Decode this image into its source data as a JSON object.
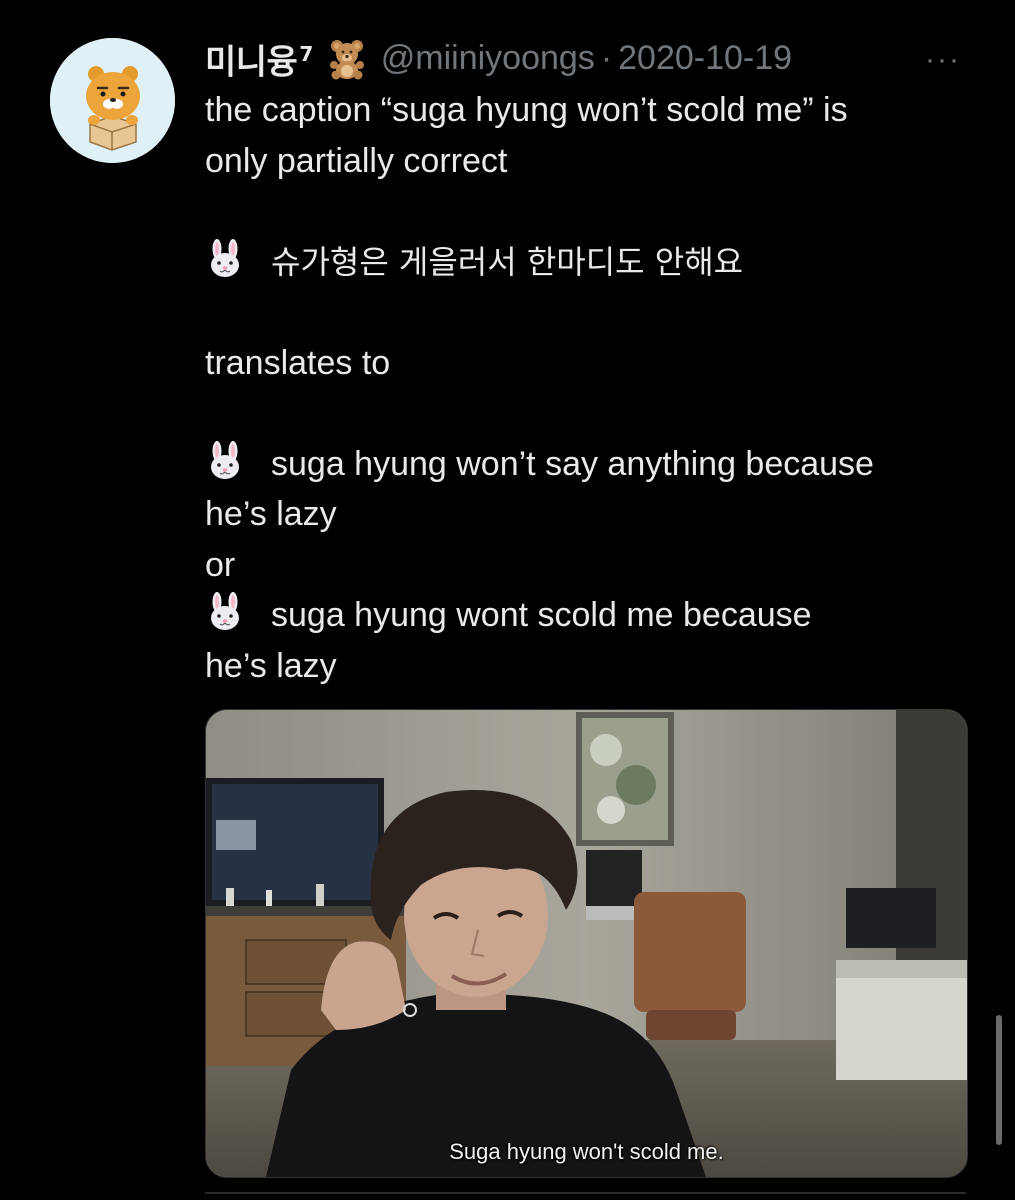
{
  "tweet": {
    "display_name": "미니융",
    "display_name_sup": "7",
    "name_emoji_icon": "teddy-bear-icon",
    "handle": "@miiniyoongs",
    "separator": "·",
    "date": "2020-10-19",
    "more_label": "···",
    "avatar_icon": "ryan-character-avatar",
    "text": {
      "line1": "the caption “suga hyung won’t scold me” is",
      "line2": "only partially correct",
      "korean": "슈가형은 게을러서 한마디도 안해요",
      "translates": "translates to",
      "tr1_a": "suga hyung won’t say anything because",
      "tr1_b": "he’s lazy",
      "or": "or",
      "tr2_a": "suga hyung wont scold me because",
      "tr2_b": "he’s lazy",
      "bullet_icon": "rabbit-face-icon"
    },
    "media": {
      "subtitle": "Suga hyung won't scold me."
    }
  },
  "colors": {
    "background": "#000000",
    "text": "#e7e9ea",
    "secondary": "#71767b",
    "avatar_bg": "#dff1f6"
  }
}
